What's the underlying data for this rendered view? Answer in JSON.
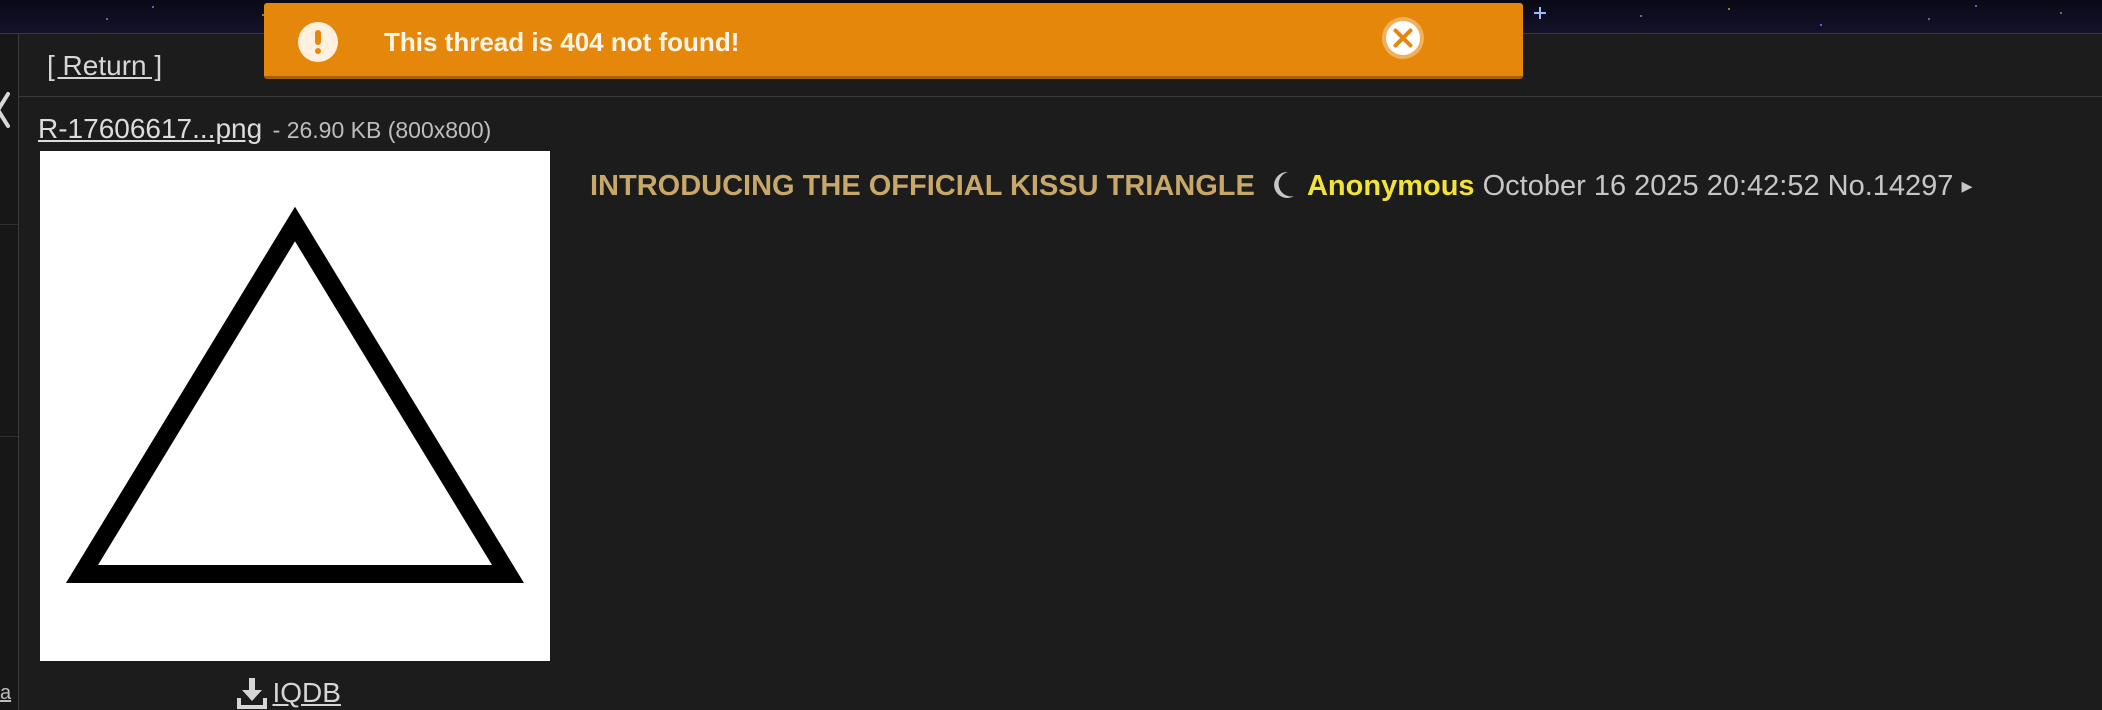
{
  "header": {
    "return_label": "[ Return ]"
  },
  "sidebar": {
    "fragment_text": "a"
  },
  "notification": {
    "message": "This thread is 404 not found!",
    "background_color": "#e5870a",
    "icon": "alert-icon",
    "close_icon": "close-icon"
  },
  "post": {
    "file_name": "R-17606617...png",
    "file_meta": "- 26.90 KB (800x800)",
    "iqdb_label": "IQDB",
    "iqdb_icon": "download-icon",
    "subject": "INTRODUCING THE OFFICIAL KISSU TRIANGLE",
    "moon_icon": "moon-icon",
    "name": "Anonymous",
    "date": "October 16 2025 20:42:52",
    "post_number": "No.14297",
    "menu_glyph": "▸",
    "colors": {
      "subject": "#c8a868",
      "name": "#f2e33a"
    }
  }
}
